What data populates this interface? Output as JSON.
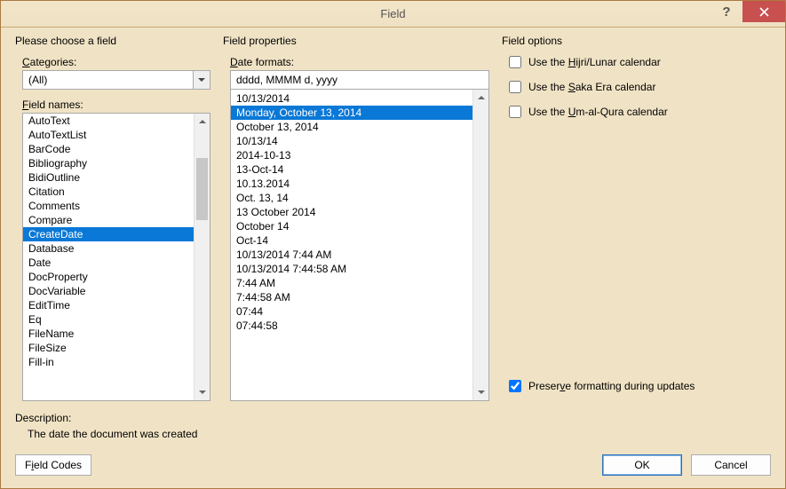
{
  "window": {
    "title": "Field"
  },
  "left": {
    "section": "Please choose a field",
    "categories_label": "Categories:",
    "categories_letter": "C",
    "categories_value": "(All)",
    "field_names_label": "Field names:",
    "field_names_letter": "F",
    "field_names": [
      "AutoText",
      "AutoTextList",
      "BarCode",
      "Bibliography",
      "BidiOutline",
      "Citation",
      "Comments",
      "Compare",
      "CreateDate",
      "Database",
      "Date",
      "DocProperty",
      "DocVariable",
      "EditTime",
      "Eq",
      "FileName",
      "FileSize",
      "Fill-in"
    ],
    "selected_field": "CreateDate"
  },
  "mid": {
    "section": "Field properties",
    "date_formats_label": "Date formats:",
    "date_formats_letter": "D",
    "format_input": "dddd, MMMM d, yyyy",
    "formats": [
      "10/13/2014",
      "Monday, October 13, 2014",
      "October 13, 2014",
      "10/13/14",
      "2014-10-13",
      "13-Oct-14",
      "10.13.2014",
      "Oct. 13, 14",
      "13 October 2014",
      "October 14",
      "Oct-14",
      "10/13/2014 7:44 AM",
      "10/13/2014 7:44:58 AM",
      "7:44 AM",
      "7:44:58 AM",
      "07:44",
      "07:44:58"
    ],
    "selected_format": "Monday, October 13, 2014"
  },
  "right": {
    "section": "Field options",
    "opt_hijri_pre": "Use the ",
    "opt_hijri_u": "H",
    "opt_hijri_post": "ijri/Lunar calendar",
    "opt_saka_pre": "Use the ",
    "opt_saka_u": "S",
    "opt_saka_post": "aka Era calendar",
    "opt_um_pre": "Use the ",
    "opt_um_u": "U",
    "opt_um_post": "m-al-Qura calendar",
    "preserve_pre": "Preser",
    "preserve_u": "v",
    "preserve_post": "e formatting during updates",
    "preserve_checked": true
  },
  "description": {
    "label": "Description:",
    "text": "The date the document was created"
  },
  "footer": {
    "field_codes_pre": "F",
    "field_codes_u": "i",
    "field_codes_post": "eld Codes",
    "ok": "OK",
    "cancel": "Cancel"
  }
}
